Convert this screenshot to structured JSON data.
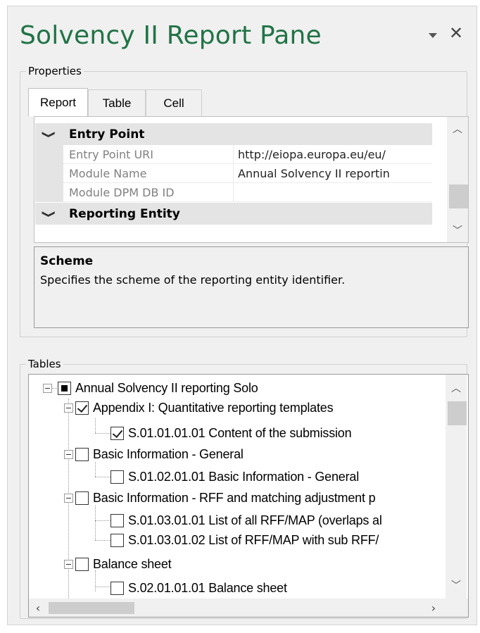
{
  "title": "Solvency II Report Pane",
  "properties_group": {
    "label": "Properties",
    "tabs": [
      {
        "label": "Report",
        "active": true
      },
      {
        "label": "Table",
        "active": false
      },
      {
        "label": "Cell",
        "active": false
      }
    ],
    "grid": {
      "categories": [
        {
          "label": "Entry Point",
          "expanded": true
        },
        {
          "label": "Reporting Entity",
          "expanded": true
        }
      ],
      "rows": [
        {
          "name": "Entry Point URI",
          "value": "http://eiopa.europa.eu/eu/"
        },
        {
          "name": "Module Name",
          "value": "Annual Solvency II reportin"
        },
        {
          "name": "Module DPM DB ID",
          "value": ""
        }
      ]
    },
    "description": {
      "title": "Scheme",
      "text": "Specifies the scheme of the reporting entity identifier."
    }
  },
  "tables_group": {
    "label": "Tables",
    "nodes": [
      {
        "level": 0,
        "label": "Annual Solvency II reporting Solo",
        "state": "partial",
        "expanded": true
      },
      {
        "level": 1,
        "label": "Appendix I: Quantitative reporting templates",
        "state": "checked",
        "expanded": true
      },
      {
        "level": 2,
        "label": "S.01.01.01.01 Content of the submission",
        "state": "checked"
      },
      {
        "level": 1,
        "label": "Basic Information - General",
        "state": "unchecked",
        "expanded": true
      },
      {
        "level": 2,
        "label": "S.01.02.01.01 Basic Information - General",
        "state": "unchecked"
      },
      {
        "level": 1,
        "label": "Basic Information - RFF and matching adjustment p",
        "state": "unchecked",
        "expanded": true
      },
      {
        "level": 2,
        "label": "S.01.03.01.01 List of all RFF/MAP (overlaps al",
        "state": "unchecked"
      },
      {
        "level": 2,
        "label": "S.01.03.01.02 List of RFF/MAP with sub RFF/",
        "state": "unchecked"
      },
      {
        "level": 1,
        "label": "Balance sheet",
        "state": "unchecked",
        "expanded": true
      },
      {
        "level": 2,
        "label": "S.02.01.01.01 Balance sheet",
        "state": "unchecked"
      }
    ]
  },
  "icons": {
    "pane_menu": "dropdown-triangle-icon",
    "close": "close-icon",
    "collapse": "chevron-down-icon",
    "scroll_up": "chevron-up-icon",
    "scroll_down": "chevron-down-icon",
    "scroll_left": "chevron-left-icon",
    "scroll_right": "chevron-right-icon",
    "expander": "collapse-minus-icon"
  },
  "colors": {
    "title": "#217346",
    "pane_bg": "#f0f0f0",
    "category_bg": "#e4e4e4"
  }
}
